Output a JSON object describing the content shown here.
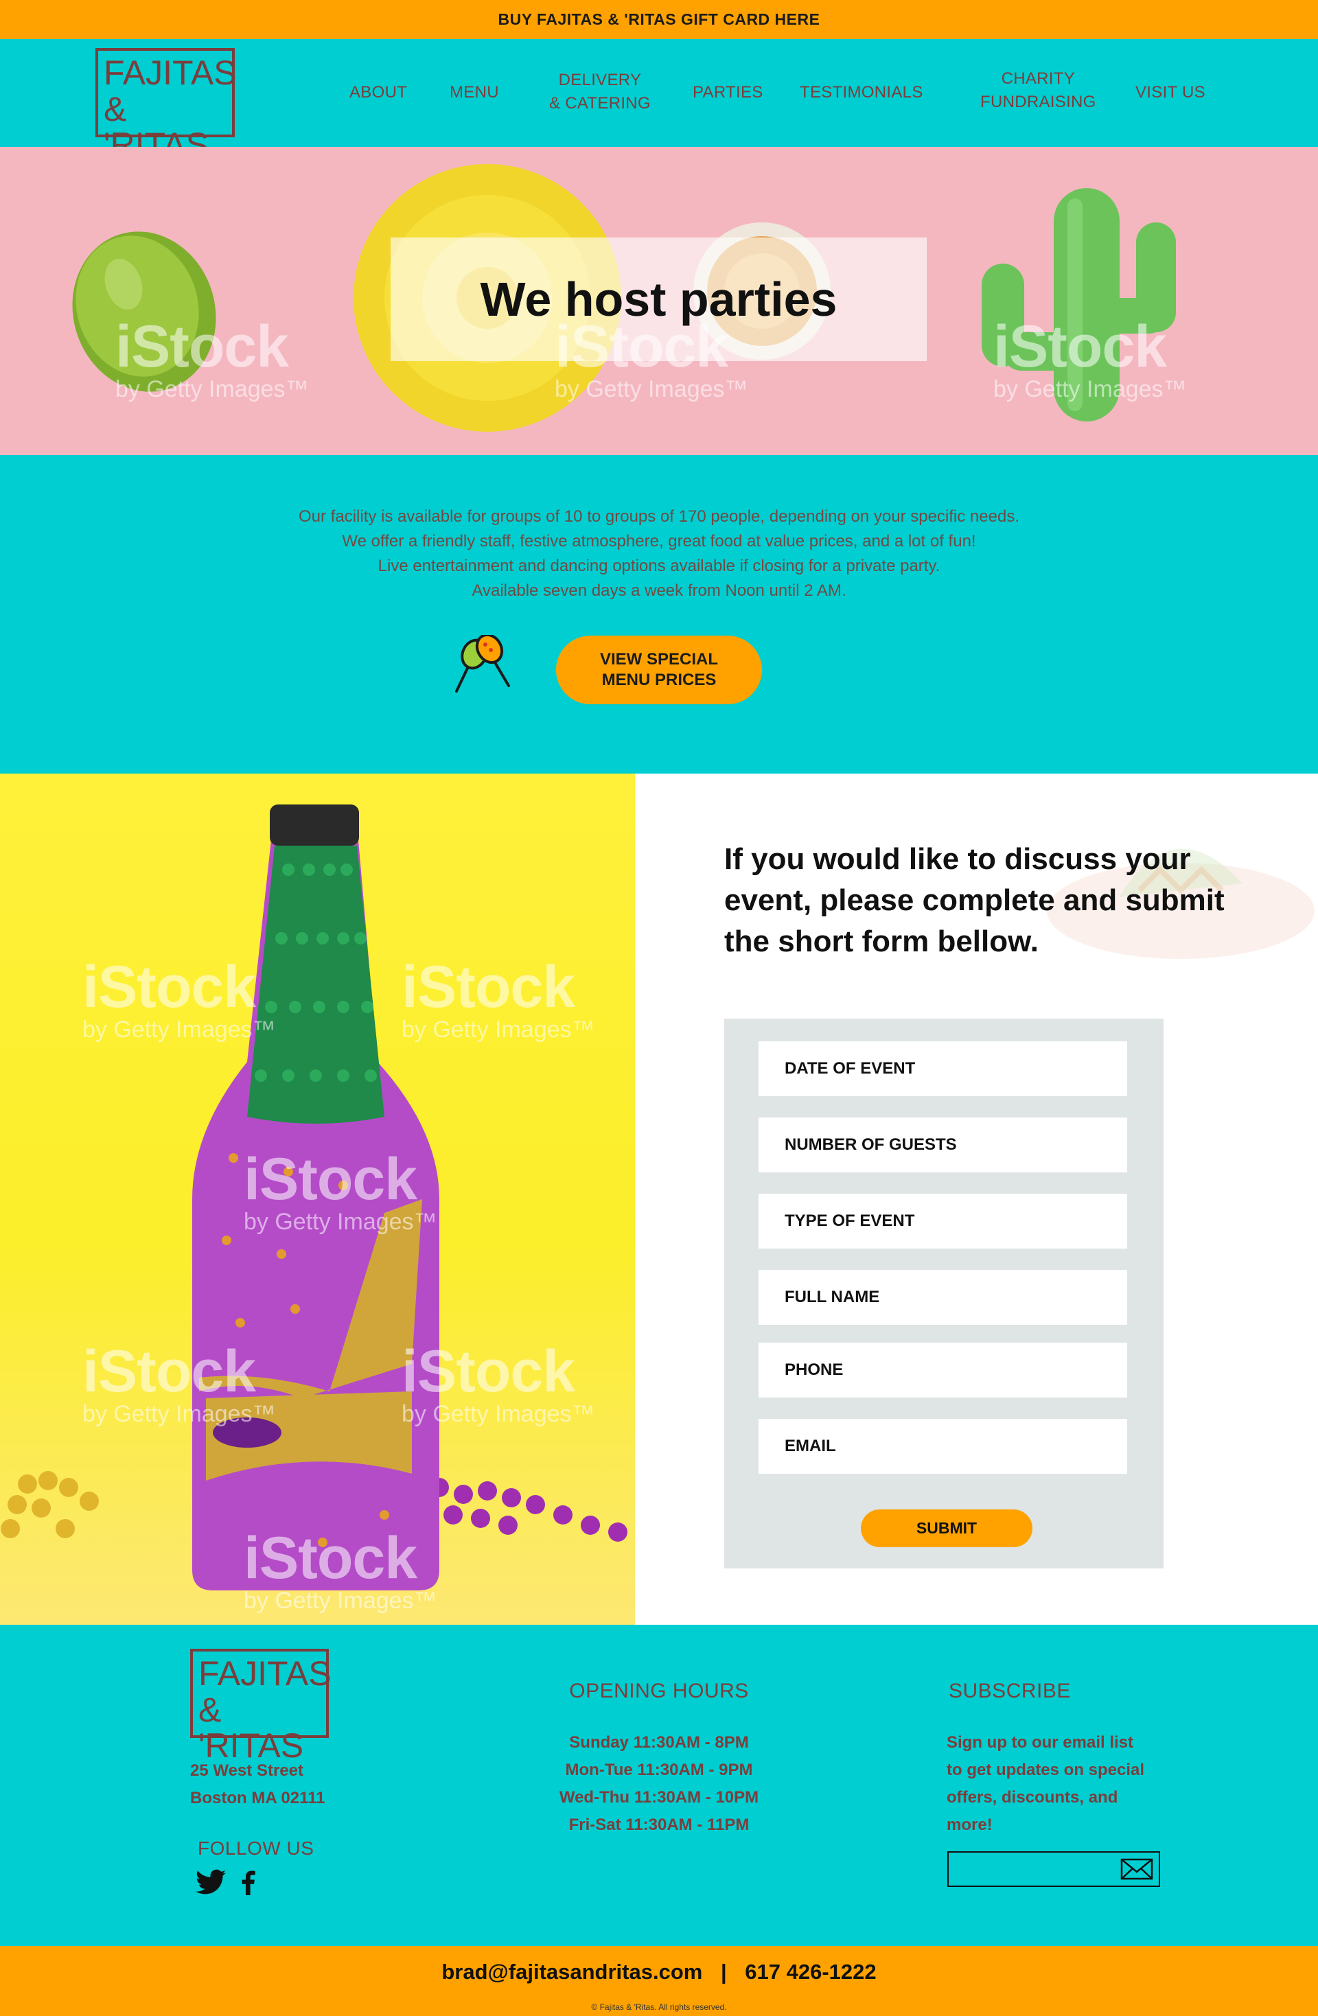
{
  "topbar": {
    "text": "BUY FAJITAS & 'RITAS GIFT CARD HERE"
  },
  "brand": {
    "line1": "FAJITAS",
    "line2": "& 'RITAS"
  },
  "nav": {
    "about": "ABOUT",
    "menu": "MENU",
    "delivery_1": "DELIVERY",
    "delivery_2": "& CATERING",
    "parties": "PARTIES",
    "testimonials": "TESTIMONIALS",
    "charity_1": "CHARITY",
    "charity_2": "FUNDRAISING",
    "visit": "VISIT US"
  },
  "hero": {
    "title": "We host parties",
    "watermark_main": "iStock",
    "watermark_sub": "by Getty Images™"
  },
  "intro": {
    "lines": [
      "Our facility is available for groups of 10 to groups of 170 people, depending on your specific needs.",
      "We offer a friendly staff, festive atmosphere, great food at value prices, and a lot of fun!",
      "Live entertainment and dancing options available if closing for a private party.",
      "Available seven days a week from Noon until 2 AM."
    ],
    "cta_line1": "VIEW SPECIAL",
    "cta_line2": "MENU PRICES"
  },
  "form": {
    "heading": "If you would like to discuss your event, please complete and submit the short form bellow.",
    "fields": {
      "date": "DATE OF EVENT",
      "guests": "NUMBER OF GUESTS",
      "type": "TYPE OF EVENT",
      "name": "FULL NAME",
      "phone": "PHONE",
      "email": "EMAIL"
    },
    "submit": "SUBMIT"
  },
  "footer": {
    "address_1": "25 West Street",
    "address_2": "Boston MA 02111",
    "follow": "FOLLOW US",
    "hours_title": "OPENING HOURS",
    "hours": [
      "Sunday 11:30AM - 8PM",
      "Mon-Tue 11:30AM - 9PM",
      "Wed-Thu 11:30AM - 10PM",
      "Fri-Sat 11:30AM - 11PM"
    ],
    "subscribe_title": "SUBSCRIBE",
    "subscribe_text": [
      "Sign up to our email list",
      "to get updates on special",
      "offers, discounts, and",
      "more!"
    ]
  },
  "bottom": {
    "email": "brad@fajitasandritas.com",
    "separator": "|",
    "phone": "617 426-1222",
    "copyright": "© Fajitas & 'Ritas. All rights reserved."
  },
  "colors": {
    "teal": "#00ced1",
    "orange": "#ffa200",
    "brown": "#7a3e3c",
    "pink": "#f4b7c0",
    "yellow": "#fff13a"
  }
}
